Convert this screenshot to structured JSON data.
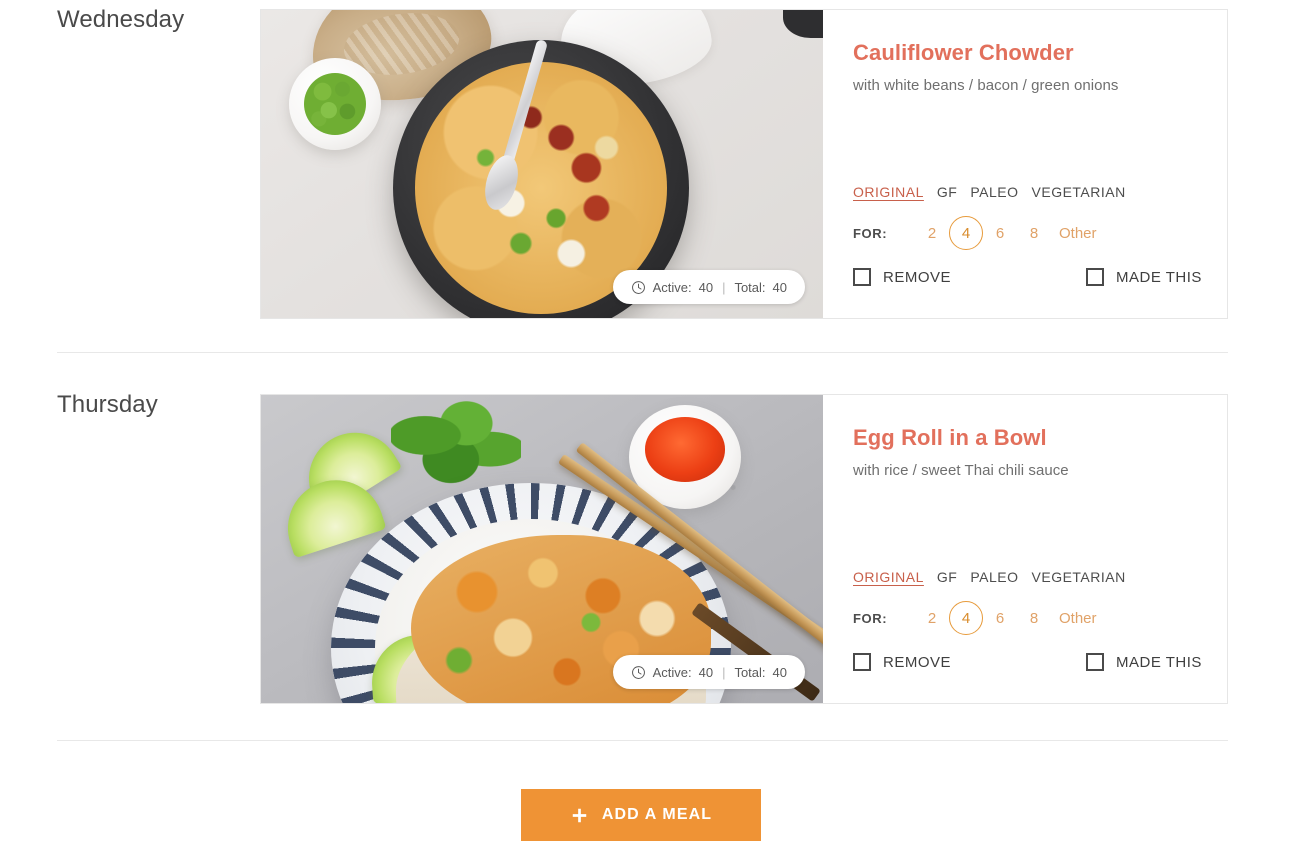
{
  "meals": [
    {
      "day": "Wednesday",
      "title": "Cauliflower Chowder",
      "subtitle": "with white beans / bacon / green onions",
      "time": {
        "active_label": "Active:",
        "active_value": "40",
        "separator": "|",
        "total_label": "Total:",
        "total_value": "40"
      },
      "variants": [
        {
          "label": "ORIGINAL",
          "selected": true
        },
        {
          "label": "GF",
          "selected": false
        },
        {
          "label": "PALEO",
          "selected": false
        },
        {
          "label": "VEGETARIAN",
          "selected": false
        }
      ],
      "servings": {
        "label": "FOR:",
        "options": [
          "2",
          "4",
          "6",
          "8"
        ],
        "selected": "4",
        "other_label": "Other"
      },
      "actions": {
        "remove_label": "REMOVE",
        "made_this_label": "MADE THIS"
      },
      "photo": "cauliflower-chowder-photo"
    },
    {
      "day": "Thursday",
      "title": "Egg Roll in a Bowl",
      "subtitle": "with rice / sweet Thai chili sauce",
      "time": {
        "active_label": "Active:",
        "active_value": "40",
        "separator": "|",
        "total_label": "Total:",
        "total_value": "40"
      },
      "variants": [
        {
          "label": "ORIGINAL",
          "selected": true
        },
        {
          "label": "GF",
          "selected": false
        },
        {
          "label": "PALEO",
          "selected": false
        },
        {
          "label": "VEGETARIAN",
          "selected": false
        }
      ],
      "servings": {
        "label": "FOR:",
        "options": [
          "2",
          "4",
          "6",
          "8"
        ],
        "selected": "4",
        "other_label": "Other"
      },
      "actions": {
        "remove_label": "REMOVE",
        "made_this_label": "MADE THIS"
      },
      "photo": "egg-roll-bowl-photo"
    }
  ],
  "add_meal": {
    "label": "ADD A MEAL",
    "icon": "plus-icon"
  },
  "colors": {
    "accent_orange": "#ef9335",
    "title_red": "#e2705c",
    "variant_active": "#c8604b",
    "serving_orange": "#e0a268",
    "serving_selected_border": "#e79b3c",
    "day_text": "#4a4a4a",
    "subtitle_text": "#6f6f6f",
    "divider": "#e8e8e8",
    "card_border": "#e6e6e6"
  }
}
